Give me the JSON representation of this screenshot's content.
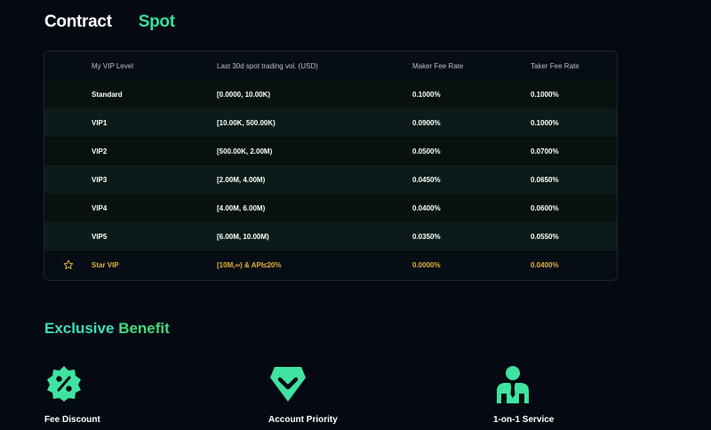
{
  "tabs": [
    {
      "label": "Contract"
    },
    {
      "label": "Spot"
    }
  ],
  "table": {
    "headers": [
      "My VIP Level",
      "Last 30d spot trading vol. (USD)",
      "Maker Fee Rate",
      "Taker Fee Rate"
    ],
    "rows": [
      {
        "level": "Standard",
        "volume": "[0.0000, 10.00K)",
        "maker": "0.1000%",
        "taker": "0.1000%"
      },
      {
        "level": "VIP1",
        "volume": "[10.00K, 500.00K)",
        "maker": "0.0900%",
        "taker": "0.1000%"
      },
      {
        "level": "VIP2",
        "volume": "[500.00K, 2.00M)",
        "maker": "0.0500%",
        "taker": "0.0700%"
      },
      {
        "level": "VIP3",
        "volume": "[2.00M, 4.00M)",
        "maker": "0.0450%",
        "taker": "0.0650%"
      },
      {
        "level": "VIP4",
        "volume": "[4.00M, 6.00M)",
        "maker": "0.0400%",
        "taker": "0.0600%"
      },
      {
        "level": "VIP5",
        "volume": "[6.00M, 10.00M)",
        "maker": "0.0350%",
        "taker": "0.0550%"
      },
      {
        "level": "Star VIP",
        "volume": "[10M,∞) & API≤20%",
        "maker": "0.0000%",
        "taker": "0.0400%"
      }
    ]
  },
  "benefit_section": {
    "title_part1": "Exclusive",
    "title_part2": "Benefit",
    "items": [
      {
        "label": "Fee Discount",
        "icon": "discount-badge-icon"
      },
      {
        "label": "Account Priority",
        "icon": "shield-check-icon"
      },
      {
        "label": "1-on-1 Service",
        "icon": "person-service-icon"
      }
    ]
  },
  "colors": {
    "accent": "#3ddca0",
    "gold": "#e2b33a",
    "background": "#050a12"
  }
}
